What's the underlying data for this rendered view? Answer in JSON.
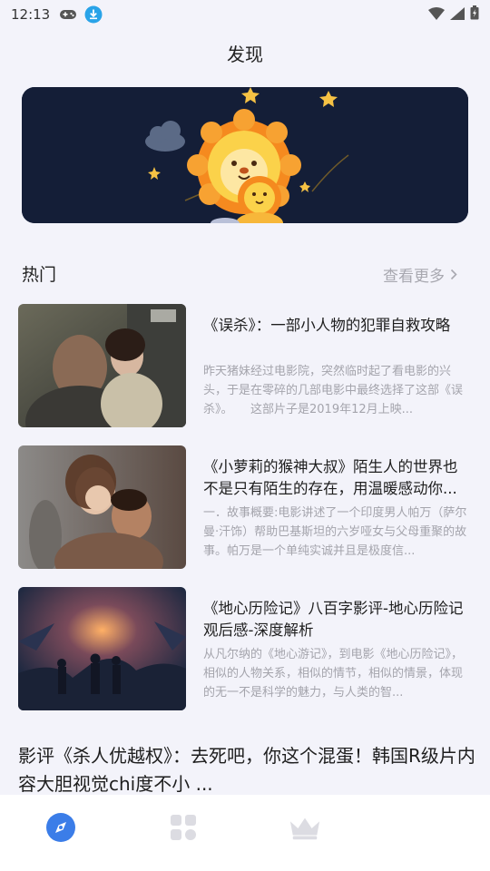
{
  "status_bar": {
    "time": "12:13",
    "icons": [
      "gamepad-icon",
      "download-icon",
      "wifi-icon",
      "signal-icon",
      "battery-icon"
    ]
  },
  "header": {
    "title": "发现"
  },
  "banner": {
    "alt": "banner"
  },
  "hot_section": {
    "title": "热门",
    "see_more": "查看更多"
  },
  "articles": [
    {
      "title": "《误杀》：一部小人物的犯罪自救攻略",
      "desc": "昨天猪妹经过电影院，突然临时起了看电影的兴头，于是在零碎的几部电影中最终选择了这部《误杀》。　　这部片子是2019年12月上映..."
    },
    {
      "title": "《小萝莉的猴神大叔》陌生人的世界也不是只有陌生的存在，用温暖感动你...",
      "desc": "一．故事概要:电影讲述了一个印度男人帕万（萨尔曼·汗饰）帮助巴基斯坦的六岁哑女与父母重聚的故事。帕万是一个单纯实诚并且是极度信..."
    },
    {
      "title": "《地心历险记》八百字影评-地心历险记观后感-深度解析",
      "desc": "从凡尔纳的《地心游记》，到电影《地心历险记》，相似的人物关系，相似的情节，相似的情景，体现的无一不是科学的魅力，与人类的智..."
    }
  ],
  "headline": "影评《杀人优越权》：去死吧，你这个混蛋！韩国R级片内容大胆视觉chi度不小 ...",
  "bottom_nav": {
    "items": [
      "compass-icon",
      "grid-icon",
      "crown-icon"
    ],
    "active_color": "#3b7de8",
    "inactive_color": "#dcdce2"
  }
}
